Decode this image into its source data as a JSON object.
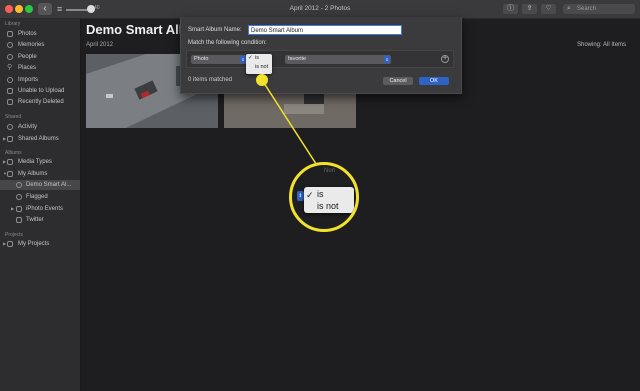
{
  "window": {
    "title": "April 2012 - 2 Photos",
    "zoom_label": "40",
    "search_placeholder": "Search"
  },
  "sidebar": {
    "library_header": "Library",
    "library_items": [
      "Photos",
      "Memories",
      "People",
      "Places",
      "Imports",
      "Unable to Upload",
      "Recently Deleted"
    ],
    "shared_header": "Shared",
    "shared_items": [
      "Activity",
      "Shared Albums"
    ],
    "albums_header": "Albums",
    "albums_items": [
      "Media Types",
      "My Albums",
      "Demo Smart Al...",
      "Flagged",
      "iPhoto Events",
      "Twitter"
    ],
    "projects_header": "Projects",
    "projects_items": [
      "My Projects"
    ]
  },
  "main": {
    "title": "Demo Smart Alb",
    "date": "April 2012",
    "showing": "Showing: All Items"
  },
  "dialog": {
    "name_label": "Smart Album Name:",
    "name_value": "Demo Smart Album",
    "match_label": "Match the following condition:",
    "rule": {
      "field": "Photo",
      "operator": "is",
      "value": "favorite"
    },
    "operator_options": [
      "is",
      "is not"
    ],
    "matched": "0 items matched",
    "cancel": "Cancel",
    "ok": "OK"
  },
  "callout": {
    "behind_text": "Non",
    "options": [
      "is",
      "is not"
    ]
  },
  "colors": {
    "accent": "#2f62c5",
    "callout": "#f2e22c",
    "selection": "#474749"
  }
}
